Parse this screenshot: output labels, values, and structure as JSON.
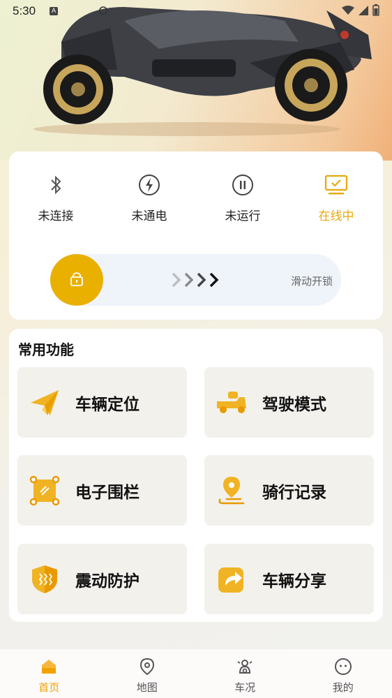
{
  "status_bar": {
    "time": "5:30",
    "a_icon": "A"
  },
  "hero": {
    "image": "scooter-photo"
  },
  "status": {
    "items": [
      {
        "label": "未连接",
        "icon": "bluetooth-icon"
      },
      {
        "label": "未通电",
        "icon": "power-bolt-icon"
      },
      {
        "label": "未运行",
        "icon": "pause-icon"
      },
      {
        "label": "在线中",
        "icon": "monitor-check-icon",
        "active": true
      }
    ],
    "accent_color": "#e8a80c"
  },
  "slider": {
    "text": "滑动开锁",
    "knob_icon": "lock-icon",
    "knob_color": "#eab000"
  },
  "functions": {
    "title": "常用功能",
    "tiles": [
      {
        "label": "车辆定位",
        "icon": "paper-plane-icon"
      },
      {
        "label": "驾驶模式",
        "icon": "scooter-icon"
      },
      {
        "label": "电子围栏",
        "icon": "fence-icon"
      },
      {
        "label": "骑行记录",
        "icon": "location-pin-icon"
      },
      {
        "label": "震动防护",
        "icon": "shield-icon"
      },
      {
        "label": "车辆分享",
        "icon": "share-icon"
      }
    ]
  },
  "nav": {
    "items": [
      {
        "label": "首页",
        "icon": "home-icon",
        "active": true
      },
      {
        "label": "地图",
        "icon": "map-pin-icon"
      },
      {
        "label": "车况",
        "icon": "vehicle-status-icon"
      },
      {
        "label": "我的",
        "icon": "profile-icon"
      }
    ]
  }
}
